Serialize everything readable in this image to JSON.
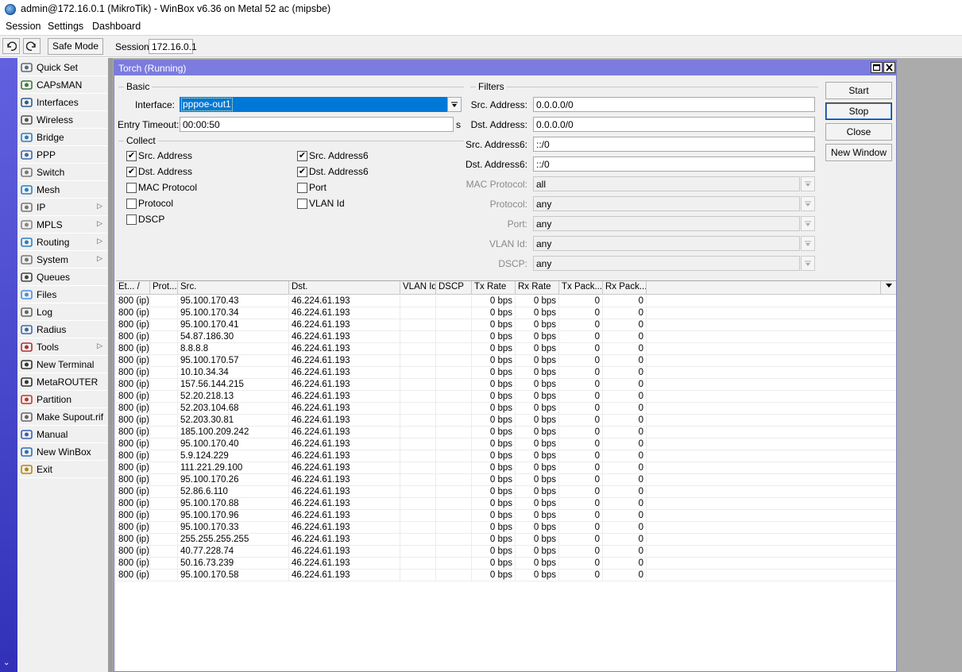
{
  "window": {
    "title": "admin@172.16.0.1 (MikroTik) - WinBox v6.36 on Metal 52 ac (mipsbe)"
  },
  "menu": [
    "Session",
    "Settings",
    "Dashboard"
  ],
  "toolbar": {
    "undo_icon": "undo-icon",
    "redo_icon": "redo-icon",
    "safe_mode_label": "Safe Mode",
    "session_label": "Session:",
    "session_value": "172.16.0.1"
  },
  "sidebar": {
    "items": [
      {
        "label": "Quick Set",
        "icon": "quick-set-icon",
        "submenu": false
      },
      {
        "label": "CAPsMAN",
        "icon": "capsman-icon",
        "submenu": false
      },
      {
        "label": "Interfaces",
        "icon": "interfaces-icon",
        "submenu": false
      },
      {
        "label": "Wireless",
        "icon": "wireless-icon",
        "submenu": false
      },
      {
        "label": "Bridge",
        "icon": "bridge-icon",
        "submenu": false
      },
      {
        "label": "PPP",
        "icon": "ppp-icon",
        "submenu": false
      },
      {
        "label": "Switch",
        "icon": "switch-icon",
        "submenu": false
      },
      {
        "label": "Mesh",
        "icon": "mesh-icon",
        "submenu": false
      },
      {
        "label": "IP",
        "icon": "ip-icon",
        "submenu": true
      },
      {
        "label": "MPLS",
        "icon": "mpls-icon",
        "submenu": true
      },
      {
        "label": "Routing",
        "icon": "routing-icon",
        "submenu": true
      },
      {
        "label": "System",
        "icon": "system-icon",
        "submenu": true
      },
      {
        "label": "Queues",
        "icon": "queues-icon",
        "submenu": false
      },
      {
        "label": "Files",
        "icon": "files-icon",
        "submenu": false
      },
      {
        "label": "Log",
        "icon": "log-icon",
        "submenu": false
      },
      {
        "label": "Radius",
        "icon": "radius-icon",
        "submenu": false
      },
      {
        "label": "Tools",
        "icon": "tools-icon",
        "submenu": true
      },
      {
        "label": "New Terminal",
        "icon": "terminal-icon",
        "submenu": false
      },
      {
        "label": "MetaROUTER",
        "icon": "metarouter-icon",
        "submenu": false
      },
      {
        "label": "Partition",
        "icon": "partition-icon",
        "submenu": false
      },
      {
        "label": "Make Supout.rif",
        "icon": "supout-icon",
        "submenu": false
      },
      {
        "label": "Manual",
        "icon": "manual-icon",
        "submenu": false
      },
      {
        "label": "New WinBox",
        "icon": "new-winbox-icon",
        "submenu": false
      },
      {
        "label": "Exit",
        "icon": "exit-icon",
        "submenu": false
      }
    ]
  },
  "torch": {
    "title": "Torch (Running)",
    "basic": {
      "group_label": "Basic",
      "interface_label": "Interface:",
      "interface_value": "pppoe-out1",
      "entry_timeout_label": "Entry Timeout:",
      "entry_timeout_value": "00:00:50",
      "entry_timeout_unit": "s"
    },
    "collect": {
      "group_label": "Collect",
      "items": [
        {
          "label": "Src. Address",
          "checked": true
        },
        {
          "label": "Dst. Address",
          "checked": true
        },
        {
          "label": "MAC Protocol",
          "checked": false
        },
        {
          "label": "Protocol",
          "checked": false
        },
        {
          "label": "DSCP",
          "checked": false
        },
        {
          "label": "Src. Address6",
          "checked": true
        },
        {
          "label": "Dst. Address6",
          "checked": true
        },
        {
          "label": "Port",
          "checked": false
        },
        {
          "label": "VLAN Id",
          "checked": false
        }
      ]
    },
    "filters": {
      "group_label": "Filters",
      "items": [
        {
          "label": "Src. Address:",
          "value": "0.0.0.0/0",
          "enabled": true
        },
        {
          "label": "Dst. Address:",
          "value": "0.0.0.0/0",
          "enabled": true
        },
        {
          "label": "Src. Address6:",
          "value": "::/0",
          "enabled": true
        },
        {
          "label": "Dst. Address6:",
          "value": "::/0",
          "enabled": true
        },
        {
          "label": "MAC Protocol:",
          "value": "all",
          "enabled": false
        },
        {
          "label": "Protocol:",
          "value": "any",
          "enabled": false
        },
        {
          "label": "Port:",
          "value": "any",
          "enabled": false
        },
        {
          "label": "VLAN Id:",
          "value": "any",
          "enabled": false
        },
        {
          "label": "DSCP:",
          "value": "any",
          "enabled": false
        }
      ]
    },
    "buttons": {
      "start": "Start",
      "stop": "Stop",
      "close": "Close",
      "new_window": "New Window"
    },
    "table": {
      "columns": [
        "Et... /",
        "Prot...",
        "Src.",
        "Dst.",
        "VLAN Id",
        "DSCP",
        "Tx Rate",
        "Rx Rate",
        "Tx Pack...",
        "Rx Pack..."
      ],
      "rows": [
        [
          "800 (ip)",
          "",
          "95.100.170.43",
          "46.224.61.193",
          "",
          "",
          "0 bps",
          "0 bps",
          "0",
          "0"
        ],
        [
          "800 (ip)",
          "",
          "95.100.170.34",
          "46.224.61.193",
          "",
          "",
          "0 bps",
          "0 bps",
          "0",
          "0"
        ],
        [
          "800 (ip)",
          "",
          "95.100.170.41",
          "46.224.61.193",
          "",
          "",
          "0 bps",
          "0 bps",
          "0",
          "0"
        ],
        [
          "800 (ip)",
          "",
          "54.87.186.30",
          "46.224.61.193",
          "",
          "",
          "0 bps",
          "0 bps",
          "0",
          "0"
        ],
        [
          "800 (ip)",
          "",
          "8.8.8.8",
          "46.224.61.193",
          "",
          "",
          "0 bps",
          "0 bps",
          "0",
          "0"
        ],
        [
          "800 (ip)",
          "",
          "95.100.170.57",
          "46.224.61.193",
          "",
          "",
          "0 bps",
          "0 bps",
          "0",
          "0"
        ],
        [
          "800 (ip)",
          "",
          "10.10.34.34",
          "46.224.61.193",
          "",
          "",
          "0 bps",
          "0 bps",
          "0",
          "0"
        ],
        [
          "800 (ip)",
          "",
          "157.56.144.215",
          "46.224.61.193",
          "",
          "",
          "0 bps",
          "0 bps",
          "0",
          "0"
        ],
        [
          "800 (ip)",
          "",
          "52.20.218.13",
          "46.224.61.193",
          "",
          "",
          "0 bps",
          "0 bps",
          "0",
          "0"
        ],
        [
          "800 (ip)",
          "",
          "52.203.104.68",
          "46.224.61.193",
          "",
          "",
          "0 bps",
          "0 bps",
          "0",
          "0"
        ],
        [
          "800 (ip)",
          "",
          "52.203.30.81",
          "46.224.61.193",
          "",
          "",
          "0 bps",
          "0 bps",
          "0",
          "0"
        ],
        [
          "800 (ip)",
          "",
          "185.100.209.242",
          "46.224.61.193",
          "",
          "",
          "0 bps",
          "0 bps",
          "0",
          "0"
        ],
        [
          "800 (ip)",
          "",
          "95.100.170.40",
          "46.224.61.193",
          "",
          "",
          "0 bps",
          "0 bps",
          "0",
          "0"
        ],
        [
          "800 (ip)",
          "",
          "5.9.124.229",
          "46.224.61.193",
          "",
          "",
          "0 bps",
          "0 bps",
          "0",
          "0"
        ],
        [
          "800 (ip)",
          "",
          "111.221.29.100",
          "46.224.61.193",
          "",
          "",
          "0 bps",
          "0 bps",
          "0",
          "0"
        ],
        [
          "800 (ip)",
          "",
          "95.100.170.26",
          "46.224.61.193",
          "",
          "",
          "0 bps",
          "0 bps",
          "0",
          "0"
        ],
        [
          "800 (ip)",
          "",
          "52.86.6.110",
          "46.224.61.193",
          "",
          "",
          "0 bps",
          "0 bps",
          "0",
          "0"
        ],
        [
          "800 (ip)",
          "",
          "95.100.170.88",
          "46.224.61.193",
          "",
          "",
          "0 bps",
          "0 bps",
          "0",
          "0"
        ],
        [
          "800 (ip)",
          "",
          "95.100.170.96",
          "46.224.61.193",
          "",
          "",
          "0 bps",
          "0 bps",
          "0",
          "0"
        ],
        [
          "800 (ip)",
          "",
          "95.100.170.33",
          "46.224.61.193",
          "",
          "",
          "0 bps",
          "0 bps",
          "0",
          "0"
        ],
        [
          "800 (ip)",
          "",
          "255.255.255.255",
          "46.224.61.193",
          "",
          "",
          "0 bps",
          "0 bps",
          "0",
          "0"
        ],
        [
          "800 (ip)",
          "",
          "40.77.228.74",
          "46.224.61.193",
          "",
          "",
          "0 bps",
          "0 bps",
          "0",
          "0"
        ],
        [
          "800 (ip)",
          "",
          "50.16.73.239",
          "46.224.61.193",
          "",
          "",
          "0 bps",
          "0 bps",
          "0",
          "0"
        ],
        [
          "800 (ip)",
          "",
          "95.100.170.58",
          "46.224.61.193",
          "",
          "",
          "0 bps",
          "0 bps",
          "0",
          "0"
        ]
      ]
    }
  },
  "colors": {
    "sidebar_strip": "#4545cc",
    "window_title_bar": "#7b7be0",
    "workspace": "#ababab",
    "selection": "#0078d7"
  }
}
